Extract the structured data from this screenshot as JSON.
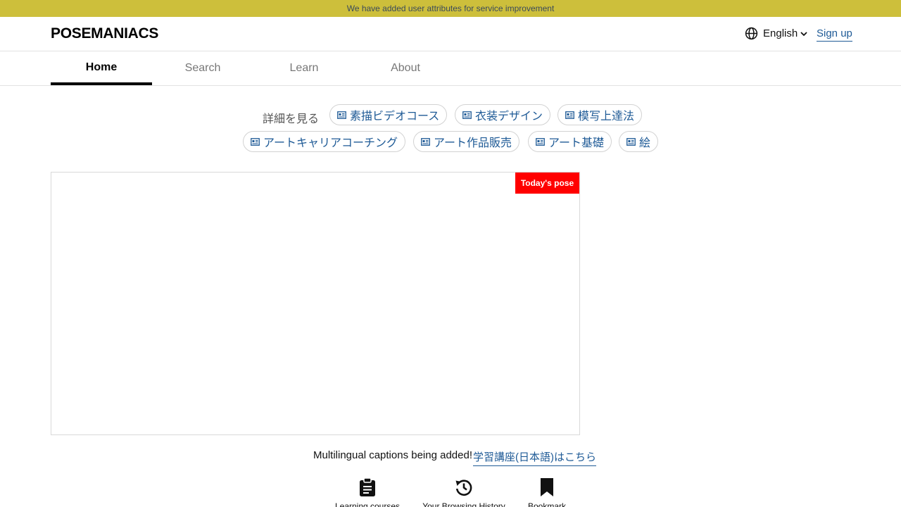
{
  "banner": {
    "text": "We have added user attributes for service improvement"
  },
  "header": {
    "logo": "POSEMANIACS",
    "language": {
      "label": "English",
      "icon": "globe-icon"
    },
    "signup_label": "Sign up"
  },
  "nav": {
    "tabs": [
      {
        "label": "Home",
        "active": true
      },
      {
        "label": "Search",
        "active": false
      },
      {
        "label": "Learn",
        "active": false
      },
      {
        "label": "About",
        "active": false
      }
    ]
  },
  "links": {
    "label": "詳細を見る",
    "chips": [
      {
        "label": "素描ビデオコース",
        "icon": "newspaper-icon"
      },
      {
        "label": "衣装デザイン",
        "icon": "newspaper-icon"
      },
      {
        "label": "模写上達法",
        "icon": "newspaper-icon"
      },
      {
        "label": "アートキャリアコーチング",
        "icon": "newspaper-icon"
      },
      {
        "label": "アート作品販売",
        "icon": "newspaper-icon"
      },
      {
        "label": "アート基礎",
        "icon": "newspaper-icon"
      },
      {
        "label": "絵",
        "icon": "newspaper-icon"
      }
    ]
  },
  "pose": {
    "badge": "Today's pose"
  },
  "caption": {
    "text": "Multilingual captions being added!",
    "link": "学習講座(日本語)はこちら"
  },
  "actions": [
    {
      "label": "Learning courses",
      "icon": "clipboard-icon"
    },
    {
      "label": "Your Browsing History",
      "icon": "history-icon"
    },
    {
      "label": "Bookmark",
      "icon": "bookmark-icon"
    }
  ],
  "colors": {
    "banner_bg": "#cdbf3b",
    "link": "#1e5a96",
    "badge_bg": "#ff0000"
  }
}
